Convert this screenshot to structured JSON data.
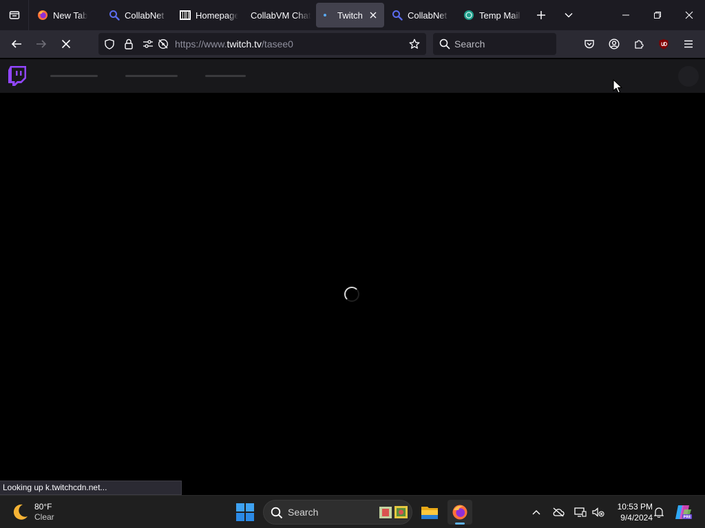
{
  "browser": {
    "tabs": [
      {
        "title": "New Tab",
        "favicon": "firefox-icon",
        "active": false
      },
      {
        "title": "CollabNet",
        "favicon": "magnifier-icon",
        "active": false
      },
      {
        "title": "Homepage",
        "favicon": "site-logo-icon",
        "active": false
      },
      {
        "title": "CollabVM Chat",
        "favicon": "none",
        "active": false
      },
      {
        "title": "Twitch",
        "favicon": "loading-dot-icon",
        "active": true
      },
      {
        "title": "CollabNet",
        "favicon": "magnifier-icon",
        "active": false
      },
      {
        "title": "Temp Mail",
        "favicon": "tempmail-icon",
        "active": false
      }
    ],
    "url_prefix": "https://www.",
    "url_domain": "twitch.tv",
    "url_path": "/tasee0",
    "search_placeholder": "Search",
    "status_text": "Looking up k.twitchcdn.net..."
  },
  "page": {
    "site": "Twitch",
    "brand_color": "#9146ff",
    "loading": true
  },
  "taskbar": {
    "weather_temp": "80°F",
    "weather_condition": "Clear",
    "search_label": "Search",
    "time": "10:53 PM",
    "date": "9/4/2024"
  }
}
